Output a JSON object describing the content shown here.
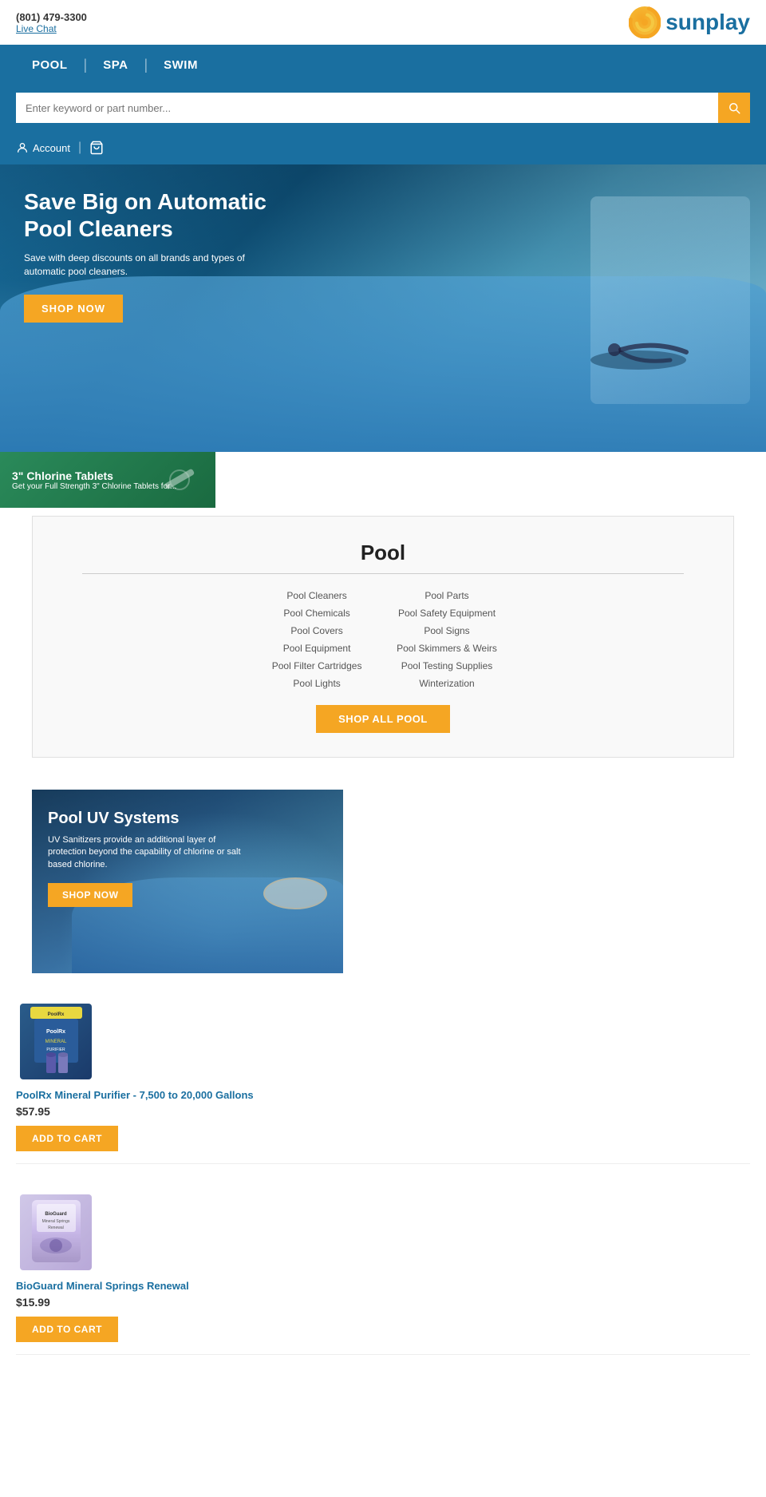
{
  "site": {
    "name": "sunplay",
    "phone": "(801) 479-3300",
    "live_chat": "Live Chat"
  },
  "nav": {
    "items": [
      "POOL",
      "SPA",
      "SWIM"
    ]
  },
  "search": {
    "placeholder": "Enter keyword or part number..."
  },
  "account": {
    "label": "Account"
  },
  "hero": {
    "title": "Save Big on Automatic Pool Cleaners",
    "subtitle": "Save with deep discounts on all brands and types of automatic pool cleaners.",
    "cta": "SHOP NOW"
  },
  "chlorine_banner": {
    "title": "3\" Chlorine Tablets",
    "subtitle": "Get your Full Strength 3\" Chlorine Tablets for..."
  },
  "pool_section": {
    "title": "Pool",
    "links_left": [
      "Pool Cleaners",
      "Pool Chemicals",
      "Pool Covers",
      "Pool Equipment",
      "Pool Filter Cartridges",
      "Pool Lights"
    ],
    "links_right": [
      "Pool Parts",
      "Pool Safety Equipment",
      "Pool Signs",
      "Pool Skimmers & Weirs",
      "Pool Testing Supplies",
      "Winterization"
    ],
    "shop_all_label": "SHOP ALL POOL"
  },
  "uv_banner": {
    "title": "Pool UV Systems",
    "subtitle": "UV Sanitizers provide an additional layer of protection beyond the capability of chlorine or salt based chlorine.",
    "cta": "SHOP NOW"
  },
  "products": [
    {
      "name": "PoolRx Mineral Purifier - 7,500 to 20,000 Gallons",
      "price": "$57.95",
      "cta": "ADD TO CART",
      "type": "poolrx"
    },
    {
      "name": "BioGuard Mineral Springs Renewal",
      "price": "$15.99",
      "cta": "ADD TO CART",
      "type": "bioguard"
    }
  ]
}
